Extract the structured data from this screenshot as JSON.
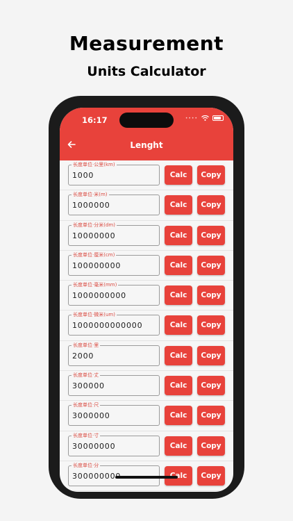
{
  "promo": {
    "title": "Measurement",
    "subtitle": "Units Calculator"
  },
  "status_bar": {
    "time": "16:17",
    "signal": "••••"
  },
  "app_bar": {
    "title": "Lenght",
    "back_icon": "arrow-left-icon"
  },
  "buttons": {
    "calc_label": "Calc",
    "copy_label": "Copy"
  },
  "colors": {
    "accent": "#e8423b",
    "label": "#d9483f",
    "background": "#f6f6f6"
  },
  "rows": [
    {
      "label": "长度单位·公里(km)",
      "value": "1000"
    },
    {
      "label": "长度单位·米(m)",
      "value": "1000000"
    },
    {
      "label": "长度单位·分米(dm)",
      "value": "10000000"
    },
    {
      "label": "长度单位·厘米(cm)",
      "value": "100000000"
    },
    {
      "label": "长度单位·毫米(mm)",
      "value": "1000000000"
    },
    {
      "label": "长度单位·微米(um)",
      "value": "1000000000000"
    },
    {
      "label": "长度单位·里",
      "value": "2000"
    },
    {
      "label": "长度单位·丈",
      "value": "300000"
    },
    {
      "label": "长度单位·尺",
      "value": "3000000"
    },
    {
      "label": "长度单位·寸",
      "value": "30000000"
    },
    {
      "label": "长度单位·分",
      "value": "300000000"
    }
  ]
}
